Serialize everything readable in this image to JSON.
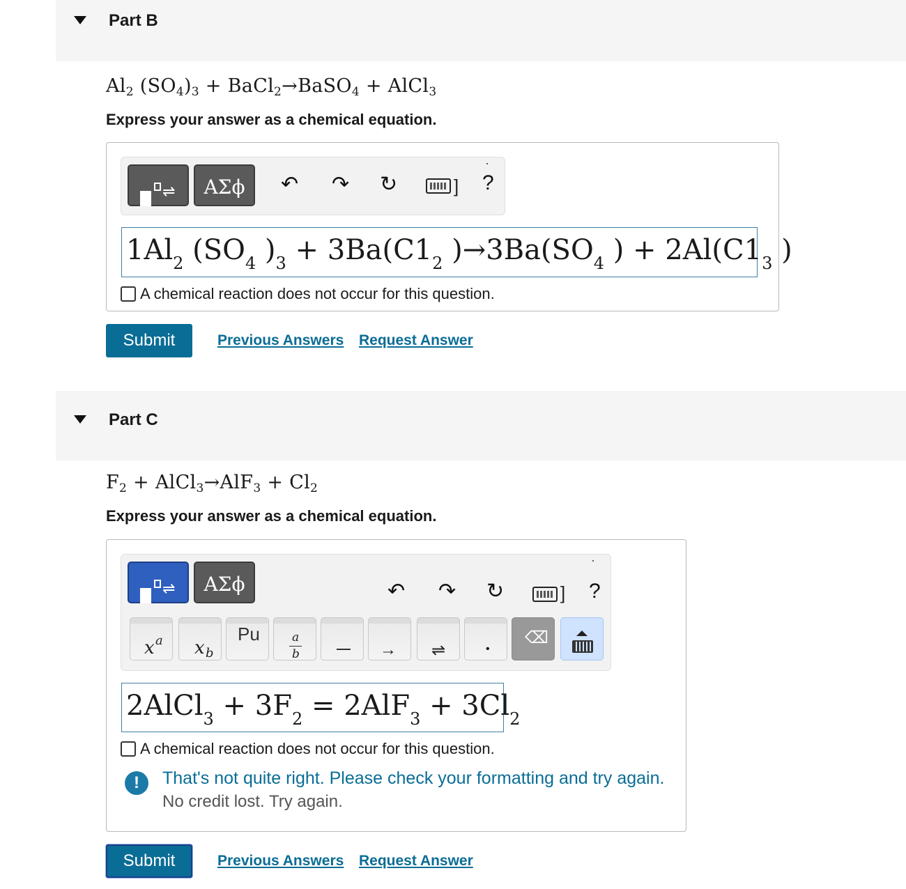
{
  "part_b": {
    "title": "Part B",
    "equation": {
      "text_1": "Al",
      "sub_1": "2",
      "text_2": " (SO",
      "sub_2": "4",
      "text_3": ")",
      "sub_3": "3",
      "text_4": " + BaCl",
      "sub_4": "2",
      "text_5": "→BaSO",
      "sub_5": "4",
      "text_6": " + AlCl",
      "sub_6": "3"
    },
    "instruction": "Express your answer as a chemical equation.",
    "toolbar": {
      "greek_label": "ΑΣϕ",
      "undo": "↶",
      "redo": "↷",
      "reset": "↻",
      "kbd_bar": "]",
      "help": "?"
    },
    "answer": {
      "t1": "1Al",
      "s1": "2",
      "t2": " (SO",
      "s2": "4",
      "t3": " )",
      "s3": "3",
      "t4": " + 3Ba(C1",
      "s4": "2",
      "t5": " )→3Ba(SO",
      "s5": "4",
      "t6": " ) + 2Al(C1",
      "s6": "3",
      "t7": " )"
    },
    "no_reaction_label": "A chemical reaction does not occur for this question.",
    "submit_label": "Submit",
    "previous_answers_label": "Previous Answers",
    "request_answer_label": "Request Answer"
  },
  "part_c": {
    "title": "Part C",
    "equation": {
      "text_1": "F",
      "sub_1": "2",
      "text_2": " + AlCl",
      "sub_2": "3",
      "text_3": "→AlF",
      "sub_3": "3",
      "text_4": " + Cl",
      "sub_4": "2"
    },
    "instruction": "Express your answer as a chemical equation.",
    "toolbar": {
      "greek_label": "ΑΣϕ",
      "undo": "↶",
      "redo": "↷",
      "reset": "↻",
      "kbd_bar": "]",
      "help": "?"
    },
    "keys": {
      "superscript": {
        "base": "x",
        "exp": "a"
      },
      "subscript": {
        "base": "x",
        "sub": "b"
      },
      "periodic": {
        "label": "Pu"
      },
      "fraction": {
        "num": "a",
        "den": "b"
      },
      "arrow": "→",
      "equilibrium": "⇌",
      "dot": "•",
      "backspace": "⌫"
    },
    "answer": {
      "t1": "2AlCl",
      "s1": "3",
      "t2": " + 3F",
      "s2": "2",
      "t3": " = 2AlF",
      "s3": "3",
      "t4": " + 3Cl",
      "s4": "2"
    },
    "no_reaction_label": "A chemical reaction does not occur for this question.",
    "feedback": {
      "icon": "!",
      "message": "That's not quite right. Please check your formatting and try again.",
      "note": "No credit lost. Try again."
    },
    "submit_label": "Submit",
    "previous_answers_label": "Previous Answers",
    "request_answer_label": "Request Answer"
  },
  "colors": {
    "accent": "#0a6d96",
    "active_tool": "#2f5fbf",
    "header_bg": "#f5f5f5"
  }
}
